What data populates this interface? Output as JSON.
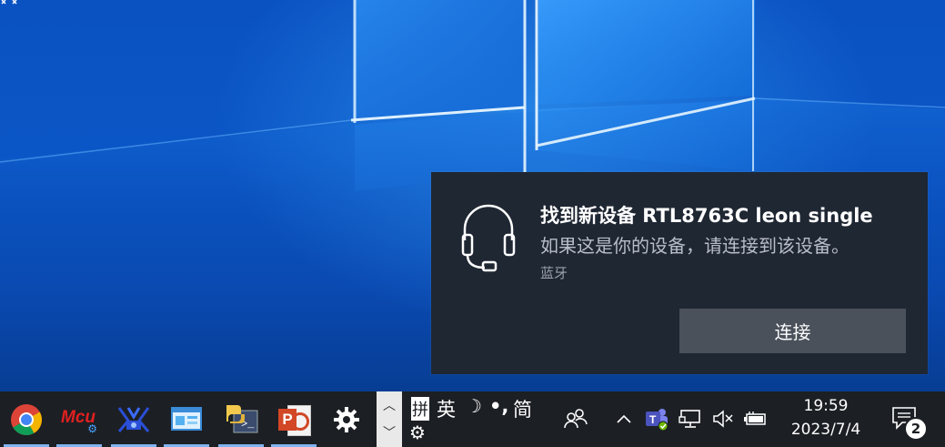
{
  "toast": {
    "title": "找到新设备 RTL8763C leon single",
    "body": "如果这是你的设备，请连接到该设备。",
    "source": "蓝牙",
    "action_label": "连接",
    "icon": "headset-icon"
  },
  "taskbar": {
    "apps": [
      {
        "name": "chrome",
        "icon": "chrome-icon"
      },
      {
        "name": "mcu",
        "icon": "mcu-tool-icon",
        "label": "Mcu"
      },
      {
        "name": "network-tool",
        "icon": "network-tool-icon"
      },
      {
        "name": "control-panel",
        "icon": "control-panel-icon"
      },
      {
        "name": "python-tool",
        "icon": "python-icon"
      },
      {
        "name": "powerpoint",
        "icon": "powerpoint-icon",
        "label": "P"
      },
      {
        "name": "settings",
        "icon": "gear-icon"
      }
    ],
    "ime": {
      "pinyin": "拼",
      "mode": "英",
      "moon": "☽",
      "punct": "•,",
      "simplified": "简"
    },
    "clock": {
      "time": "19:59",
      "date": "2023/7/4"
    },
    "notification_count": "2"
  },
  "colors": {
    "toast_bg": "#1f2733",
    "taskbar_bg": "#1c1f24",
    "button_bg": "#4a515b",
    "active_underline": "#7fb3f0"
  }
}
